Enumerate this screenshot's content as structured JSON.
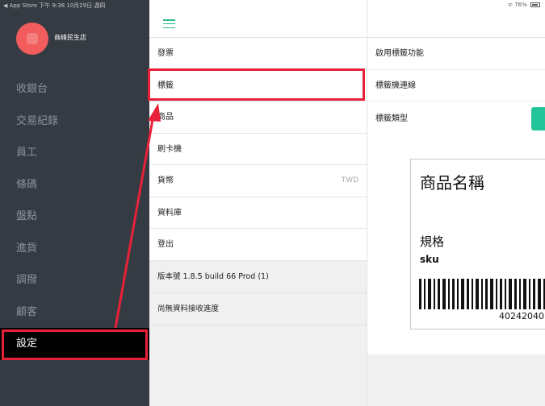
{
  "status_bar": {
    "left": "◀ App Store   下午 9:38   10月29日 週四",
    "right": "76%"
  },
  "sidebar": {
    "store_name": "商峰民生店",
    "items": [
      {
        "label": "收銀台"
      },
      {
        "label": "交易紀錄"
      },
      {
        "label": "員工"
      },
      {
        "label": "條碼"
      },
      {
        "label": "盤點"
      },
      {
        "label": "進貨"
      },
      {
        "label": "調撥"
      },
      {
        "label": "顧客"
      },
      {
        "label": "設定",
        "active": true
      }
    ]
  },
  "settings_list": {
    "items": [
      {
        "label": "發票",
        "value": ""
      },
      {
        "label": "標籤",
        "value": ""
      },
      {
        "label": "商品",
        "value": ""
      },
      {
        "label": "刷卡機",
        "value": ""
      },
      {
        "label": "貨幣",
        "value": "TWD"
      },
      {
        "label": "資料庫",
        "value": ""
      },
      {
        "label": "登出",
        "value": ""
      }
    ],
    "version": "版本號 1.8.5   build 66    Prod  (1)",
    "sync_status": "尚無資料接收進度"
  },
  "label_settings": {
    "enable_label": "啟用標籤功能",
    "label_printer": "標籤機連線",
    "label_type": "標籤類型"
  },
  "label_preview": {
    "product_name": "商品名稱",
    "spec": "規格",
    "sku": "sku",
    "barcode_number": "40242040"
  },
  "colors": {
    "sidebar_bg": "#353b42",
    "accent_green": "#22c598",
    "highlight_red": "#e8213a",
    "avatar_red": "#f25c5c"
  }
}
